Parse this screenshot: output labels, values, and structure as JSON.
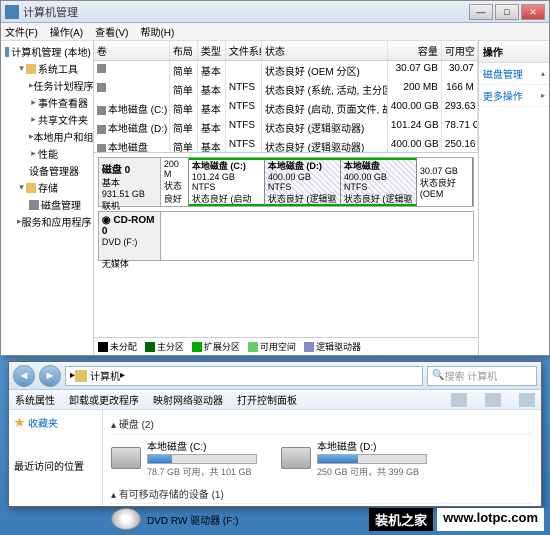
{
  "mgmt": {
    "title": "计算机管理",
    "menus": [
      "文件(F)",
      "操作(A)",
      "查看(V)",
      "帮助(H)"
    ],
    "tree": {
      "root": "计算机管理 (本地)",
      "sys_tools": "系统工具",
      "task_sched": "任务计划程序",
      "event_viewer": "事件查看器",
      "shared": "共享文件夹",
      "users": "本地用户和组",
      "perf": "性能",
      "dev_mgr": "设备管理器",
      "storage": "存储",
      "disk_mgmt": "磁盘管理",
      "services": "服务和应用程序"
    },
    "cols": {
      "vol": "卷",
      "layout": "布局",
      "type": "类型",
      "fs": "文件系统",
      "status": "状态",
      "cap": "容量",
      "free": "可用空"
    },
    "rows": [
      {
        "vol": "",
        "layout": "简单",
        "type": "基本",
        "fs": "",
        "status": "状态良好 (OEM 分区)",
        "cap": "30.07 GB",
        "free": "30.07"
      },
      {
        "vol": "",
        "layout": "简单",
        "type": "基本",
        "fs": "NTFS",
        "status": "状态良好 (系统, 活动, 主分区)",
        "cap": "200 MB",
        "free": "166 M"
      },
      {
        "vol": "本地磁盘 (C:)",
        "layout": "简单",
        "type": "基本",
        "fs": "NTFS",
        "status": "状态良好 (启动, 页面文件, 故障转储, 主分区)",
        "cap": "400.00 GB",
        "free": "293.63"
      },
      {
        "vol": "本地磁盘 (D:)",
        "layout": "简单",
        "type": "基本",
        "fs": "NTFS",
        "status": "状态良好 (逻辑驱动器)",
        "cap": "101.24 GB",
        "free": "78.71 G"
      },
      {
        "vol": "本地磁盘",
        "layout": "简单",
        "type": "基本",
        "fs": "NTFS",
        "status": "状态良好 (逻辑驱动器)",
        "cap": "400.00 GB",
        "free": "250.16"
      }
    ],
    "disk0": {
      "label": "磁盘 0",
      "type": "基本",
      "size": "931.51 GB",
      "state": "联机",
      "parts": [
        {
          "name": "",
          "size": "200 M",
          "status": "状态良好"
        },
        {
          "name": "本地磁盘 (C:)",
          "size": "101.24 GB NTFS",
          "status": "状态良好 (启动"
        },
        {
          "name": "本地磁盘 (D:)",
          "size": "400.00 GB NTFS",
          "status": "状态良好 (逻辑驱"
        },
        {
          "name": "本地磁盘",
          "size": "400.00 GB NTFS",
          "status": "状态良好 (逻辑驱"
        },
        {
          "name": "",
          "size": "30.07 GB",
          "status": "状态良好 (OEM"
        }
      ]
    },
    "cdrom": {
      "label": "CD-ROM 0",
      "type": "DVD (F:)",
      "state": "无媒体"
    },
    "legend": {
      "unalloc": "未分配",
      "primary": "主分区",
      "extended": "扩展分区",
      "free": "可用空间",
      "logical": "逻辑驱动器"
    },
    "actions": {
      "header": "操作",
      "disk_mgmt": "磁盘管理",
      "more": "更多操作"
    }
  },
  "explorer": {
    "breadcrumb": "计算机",
    "search_ph": "搜索 计算机",
    "menu": {
      "props": "系统属性",
      "uninstall": "卸载或更改程序",
      "netdrive": "映射网络驱动器",
      "ctrlpanel": "打开控制面板"
    },
    "nav": {
      "fav": "收藏夹",
      "recent": "最近访问的位置"
    },
    "sections": {
      "hdd": "硬盘 (2)",
      "removable": "有可移动存储的设备 (1)"
    },
    "drives": {
      "c": {
        "name": "本地磁盘 (C:)",
        "info": "78.7 GB 可用，共 101 GB",
        "fill": 22
      },
      "d": {
        "name": "本地磁盘 (D:)",
        "info": "250 GB 可用，共 399 GB",
        "fill": 37
      }
    },
    "dvd": "DVD RW 驱动器 (F:)"
  },
  "watermark": {
    "a": "装机之家",
    "b": "www.lotpc.com"
  }
}
